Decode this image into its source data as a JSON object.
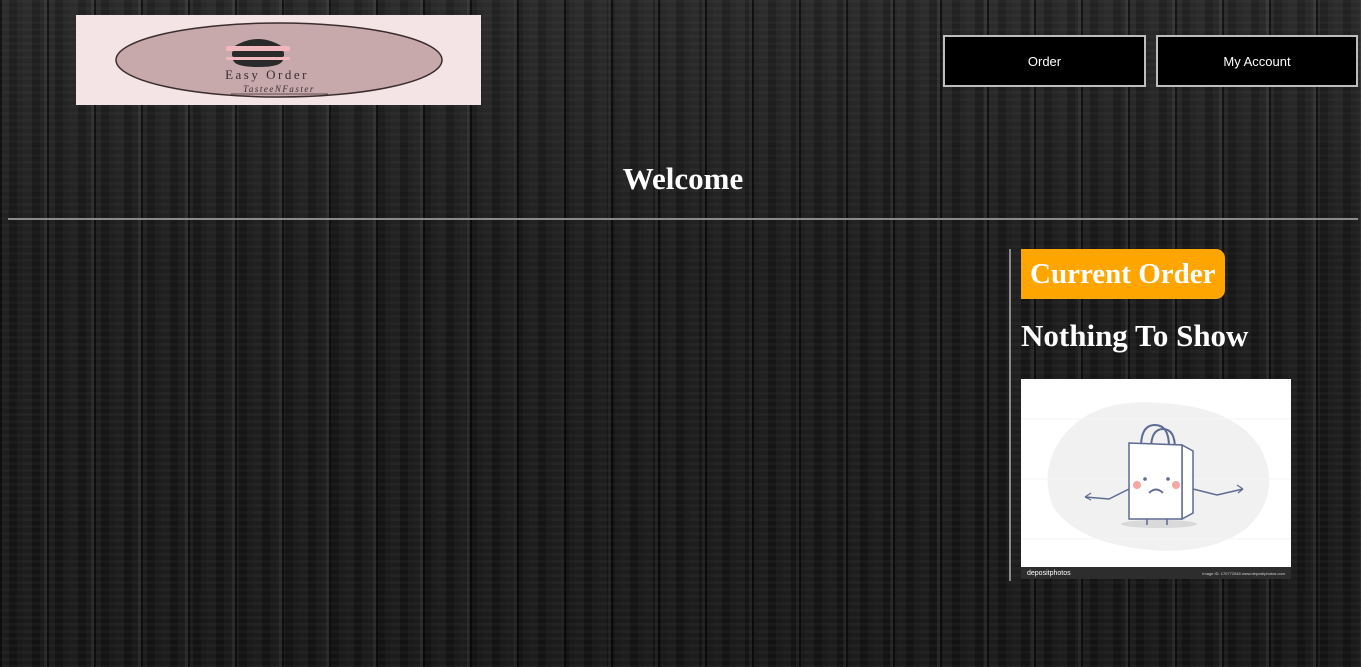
{
  "header": {
    "logo": {
      "title": "Easy Order",
      "tagline": "TasteeNFaster",
      "colors": {
        "background": "#f4e4e6",
        "oval": "#c7a9ab",
        "text": "#3a2d2e"
      }
    },
    "nav": {
      "order_label": "Order",
      "account_label": "My Account"
    }
  },
  "main": {
    "welcome_title": "Welcome"
  },
  "current_order": {
    "heading": "Current Order",
    "empty_message": "Nothing To Show",
    "illustration": {
      "icon": "sad-shopping-bag-icon",
      "watermark_brand": "depositphotos",
      "watermark_meta": "Image ID: 170772548   www.depositphotos.com"
    }
  },
  "colors": {
    "accent": "#ffa500",
    "button_border": "#bdbdbd",
    "button_bg": "#000000",
    "divider": "#8a8a8a"
  }
}
